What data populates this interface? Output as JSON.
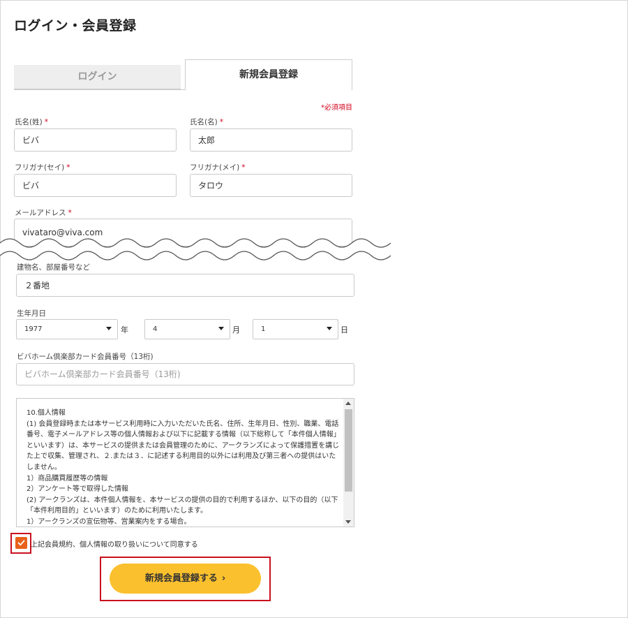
{
  "page": {
    "title": "ログイン・会員登録"
  },
  "tabs": {
    "login": "ログイン",
    "register": "新規会員登録"
  },
  "required_note": "*必須項目",
  "form": {
    "last_name": {
      "label": "氏名(姓)",
      "req": "*",
      "value": "ビバ"
    },
    "first_name": {
      "label": "氏名(名)",
      "req": "*",
      "value": "太郎"
    },
    "last_kana": {
      "label": "フリガナ(セイ)",
      "req": "*",
      "value": "ビバ"
    },
    "first_kana": {
      "label": "フリガナ(メイ)",
      "req": "*",
      "value": "タロウ"
    },
    "email": {
      "label": "メールアドレス",
      "req": "*",
      "value": "vivataro@viva.com"
    },
    "building": {
      "label": "建物名、部屋番号など",
      "value": "２番地"
    },
    "birthdate": {
      "label": "生年月日",
      "year": "1977",
      "year_unit": "年",
      "month": "4",
      "month_unit": "月",
      "day": "1",
      "day_unit": "日"
    },
    "member_card": {
      "label": "ビバホーム倶楽部カード会員番号（13桁)",
      "placeholder": "ビバホーム倶楽部カード会員番号（13桁)"
    }
  },
  "terms": {
    "lines": [
      "10.個人情報",
      "(1) 会員登録時または本サービス利用時に入力いただいた氏名、住所、生年月日、性別、職業、電話番号、電子メールアドレス等の個人情報および以下に記載する情報（以下総称して「本件個人情報」といいます）は、本サービスの提供または会員管理のために、アークランズによって保護措置を講じた上で収集、管理され、２.または３．に記述する利用目的以外には利用及び第三者への提供はいたしません。",
      "1）商品購買履歴等の情報",
      "2）アンケート等で取得した情報",
      "(2) アークランズは、本件個人情報を、本サービスの提供の目的で利用するほか、以下の目的（以下「本件利用目的」といいます）のために利用いたします。",
      "1）アークランズの宣伝物等、営業案内をする場合。"
    ]
  },
  "agree": {
    "label": "上記会員規約、個人情報の取り扱いについて同意する",
    "checked": true
  },
  "submit": {
    "label": "新規会員登録する",
    "chevron": "›"
  },
  "colors": {
    "accent_orange": "#e8611a",
    "button_yellow": "#fbc02d",
    "required_red": "#d0021b",
    "highlight_red": "#c8101e"
  }
}
